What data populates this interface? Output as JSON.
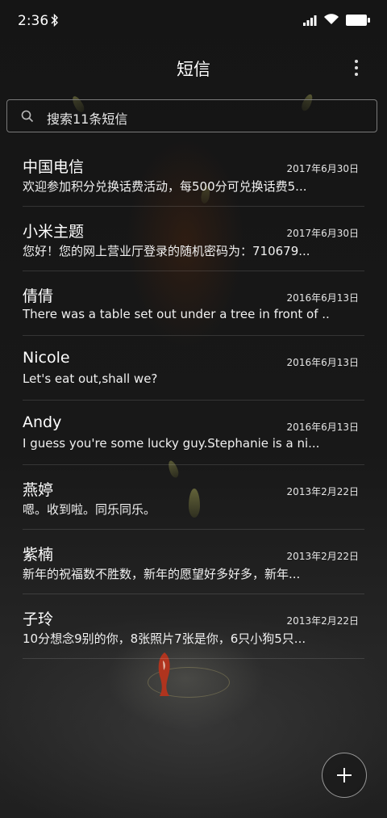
{
  "status_bar": {
    "time": "2:36",
    "icons": [
      "bluetooth-icon",
      "signal-icon",
      "wifi-icon",
      "battery-icon"
    ]
  },
  "header": {
    "title": "短信",
    "more_icon": "more-vertical-icon"
  },
  "search": {
    "placeholder": "搜索11条短信",
    "icon": "search-icon"
  },
  "messages": [
    {
      "name": "中国电信",
      "date": "2017年6月30日",
      "preview": "欢迎参加积分兑换话费活动，每500分可兑换话费5..."
    },
    {
      "name": "小米主题",
      "date": "2017年6月30日",
      "preview": "您好！您的网上营业厅登录的随机密码为：710679..."
    },
    {
      "name": "倩倩",
      "date": "2016年6月13日",
      "preview": "There was a table set out under a tree in front of ..."
    },
    {
      "name": "Nicole",
      "date": "2016年6月13日",
      "preview": "Let's eat out,shall we?"
    },
    {
      "name": "Andy",
      "date": "2016年6月13日",
      "preview": "I guess you're some lucky guy.Stephanie is a ni..."
    },
    {
      "name": "燕婷",
      "date": "2013年2月22日",
      "preview": "嗯。收到啦。同乐同乐。"
    },
    {
      "name": "紫楠",
      "date": "2013年2月22日",
      "preview": "新年的祝福数不胜数，新年的愿望好多好多，新年..."
    },
    {
      "name": "子玲",
      "date": "2013年2月22日",
      "preview": "10分想念9别的你，8张照片7张是你，6只小狗5只..."
    }
  ],
  "fab": {
    "icon": "plus-icon"
  },
  "colors": {
    "background": "#141414",
    "text": "#ffffff",
    "divider": "rgba(255,255,255,0.13)"
  }
}
